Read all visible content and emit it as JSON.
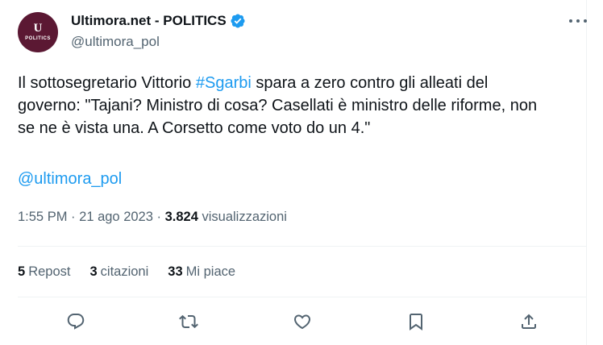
{
  "account": {
    "display_name": "Ultimora.net - POLITICS",
    "handle": "@ultimora_pol",
    "avatar_mark": "U",
    "avatar_sub": "POLITICS",
    "avatar_color": "#5b1833",
    "verified_icon": "verified-badge-icon"
  },
  "tweet": {
    "line1_before": "Il sottosegretario Vittorio ",
    "hashtag": "#Sgarbi",
    "line1_after": " spara a zero contro gli alleati del",
    "line2": "governo: \"Tajani? Ministro di cosa? Casellati è ministro delle riforme, non",
    "line3": "se ne è vista una. A Corsetto come voto do un 4.\"",
    "mention": "@ultimora_pol"
  },
  "meta": {
    "time": "1:55 PM",
    "date": "21 ago 2023",
    "views_count": "3.824",
    "views_label": "visualizzazioni"
  },
  "stats": {
    "reposts_count": "5",
    "reposts_label": "Repost",
    "quotes_count": "3",
    "quotes_label": "citazioni",
    "likes_count": "33",
    "likes_label": "Mi piace"
  },
  "colors": {
    "accent": "#1d9bf0",
    "text": "#0f1419",
    "muted": "#536471"
  },
  "icons": [
    "more-icon",
    "reply-icon",
    "repost-icon",
    "like-icon",
    "bookmark-icon",
    "share-icon"
  ]
}
